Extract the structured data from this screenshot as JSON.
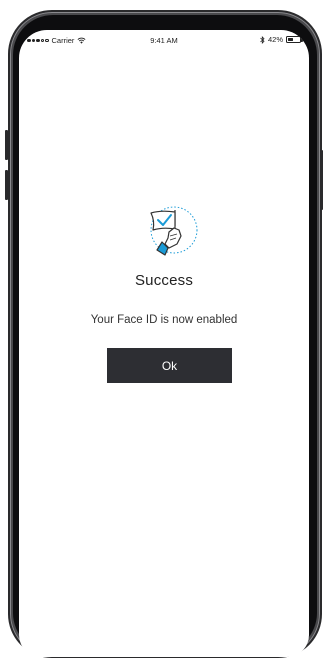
{
  "status_bar": {
    "carrier": "Carrier",
    "time": "9:41 AM",
    "battery_percent": "42%",
    "battery_level": 0.42
  },
  "illustration": {
    "icon": "flag-checkmark-icon",
    "accent_color": "#1a9bd7"
  },
  "success": {
    "title": "Success",
    "message": "Your Face ID is now enabled",
    "ok_label": "Ok"
  },
  "colors": {
    "button_bg": "#2d2e33",
    "button_text": "#ffffff",
    "accent": "#1a9bd7"
  }
}
